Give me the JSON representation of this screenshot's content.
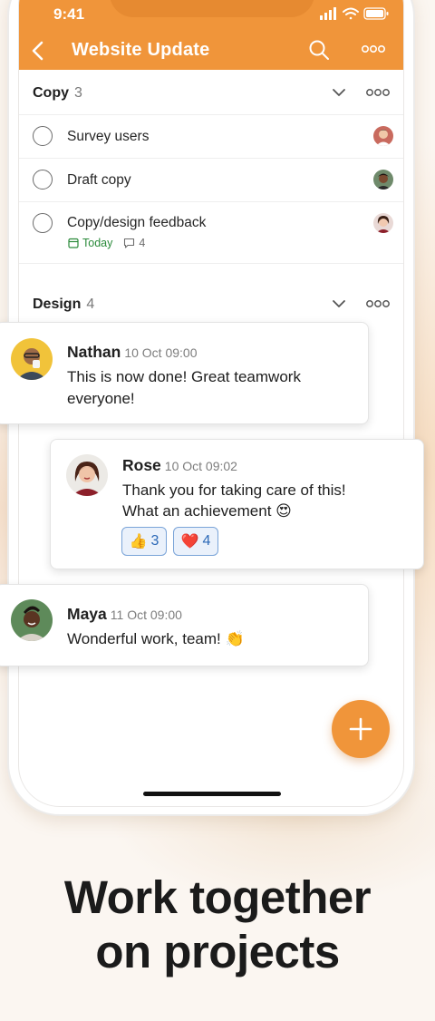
{
  "status": {
    "time": "9:41"
  },
  "appbar": {
    "title": "Website Update"
  },
  "sections": [
    {
      "name": "Copy",
      "count": "3"
    },
    {
      "name": "Design",
      "count": "4"
    }
  ],
  "tasks": [
    {
      "label": "Survey users"
    },
    {
      "label": "Draft copy"
    },
    {
      "label": "Copy/design feedback",
      "due": "Today",
      "comments": "4"
    }
  ],
  "messages": [
    {
      "name": "Nathan",
      "time": "10 Oct 09:00",
      "line1": "This is now done! Great teamwork",
      "line2": "everyone!"
    },
    {
      "name": "Rose",
      "time": "10 Oct 09:02",
      "line1": "Thank you for taking care of this!",
      "line2": "What an achievement 😍",
      "reactions": [
        {
          "emoji": "👍",
          "count": "3"
        },
        {
          "emoji": "❤️",
          "count": "4"
        }
      ]
    },
    {
      "name": "Maya",
      "time": "11 Oct 09:00",
      "line1": "Wonderful work, team! 👏"
    }
  ],
  "headline": {
    "line1": "Work together",
    "line2": "on projects"
  },
  "colors": {
    "accent": "#f0953a",
    "today": "#2a8a3a",
    "reaction_border": "#7aa4d8"
  }
}
